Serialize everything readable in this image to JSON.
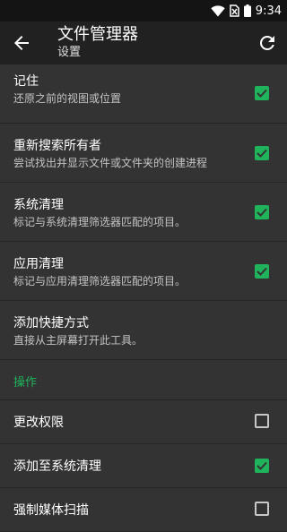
{
  "status": {
    "time": "9:34"
  },
  "appbar": {
    "title": "文件管理器",
    "subtitle": "设置"
  },
  "settings": [
    {
      "label": "记住",
      "desc": "还原之前的视图或位置",
      "checked": true
    },
    {
      "label": "重新搜索所有者",
      "desc": "尝试找出并显示文件或文件夹的创建进程",
      "checked": true
    },
    {
      "label": "系统清理",
      "desc": "标记与系统清理筛选器匹配的项目。",
      "checked": true
    },
    {
      "label": "应用清理",
      "desc": "标记与应用清理筛选器匹配的项目。",
      "checked": true
    },
    {
      "label": "添加快捷方式",
      "desc": "直接从主屏幕打开此工具。"
    }
  ],
  "section": {
    "label": "操作"
  },
  "actions": [
    {
      "label": "更改权限",
      "checked": false
    },
    {
      "label": "添加至系统清理",
      "checked": true
    },
    {
      "label": "强制媒体扫描",
      "checked": false
    }
  ],
  "colors": {
    "accent": "#1fb35c",
    "background": "#333333",
    "appbar": "#212121"
  }
}
